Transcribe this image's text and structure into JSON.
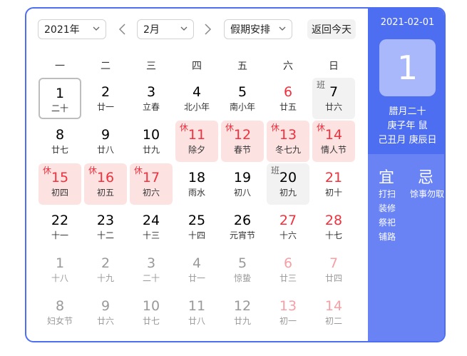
{
  "toolbar": {
    "year_value": "2021年",
    "month_value": "2月",
    "holiday_value": "假期安排",
    "today_label": "返回今天"
  },
  "weekdays": [
    "一",
    "二",
    "三",
    "四",
    "五",
    "六",
    "日"
  ],
  "days": [
    {
      "num": "1",
      "lunar": "二十",
      "today": true
    },
    {
      "num": "2",
      "lunar": "廿一"
    },
    {
      "num": "3",
      "lunar": "立春"
    },
    {
      "num": "4",
      "lunar": "北小年"
    },
    {
      "num": "5",
      "lunar": "南小年"
    },
    {
      "num": "6",
      "lunar": "廿五",
      "red": true
    },
    {
      "num": "7",
      "lunar": "廿六",
      "tag": "班",
      "type": "work"
    },
    {
      "num": "8",
      "lunar": "廿七"
    },
    {
      "num": "9",
      "lunar": "廿八"
    },
    {
      "num": "10",
      "lunar": "廿九"
    },
    {
      "num": "11",
      "lunar": "除夕",
      "tag": "休",
      "type": "rest"
    },
    {
      "num": "12",
      "lunar": "春节",
      "tag": "休",
      "type": "rest"
    },
    {
      "num": "13",
      "lunar": "冬七九",
      "tag": "休",
      "type": "rest"
    },
    {
      "num": "14",
      "lunar": "情人节",
      "tag": "休",
      "type": "rest"
    },
    {
      "num": "15",
      "lunar": "初四",
      "tag": "休",
      "type": "rest"
    },
    {
      "num": "16",
      "lunar": "初五",
      "tag": "休",
      "type": "rest"
    },
    {
      "num": "17",
      "lunar": "初六",
      "tag": "休",
      "type": "rest"
    },
    {
      "num": "18",
      "lunar": "雨水"
    },
    {
      "num": "19",
      "lunar": "初八"
    },
    {
      "num": "20",
      "lunar": "初九",
      "tag": "班",
      "type": "work"
    },
    {
      "num": "21",
      "lunar": "初十",
      "red": true
    },
    {
      "num": "22",
      "lunar": "十一"
    },
    {
      "num": "23",
      "lunar": "十二"
    },
    {
      "num": "24",
      "lunar": "十三"
    },
    {
      "num": "25",
      "lunar": "十四"
    },
    {
      "num": "26",
      "lunar": "元宵节"
    },
    {
      "num": "27",
      "lunar": "十六",
      "red": true
    },
    {
      "num": "28",
      "lunar": "十七",
      "red": true
    },
    {
      "num": "1",
      "lunar": "十八",
      "other": true
    },
    {
      "num": "2",
      "lunar": "十九",
      "other": true
    },
    {
      "num": "3",
      "lunar": "二十",
      "other": true
    },
    {
      "num": "4",
      "lunar": "廿一",
      "other": true
    },
    {
      "num": "5",
      "lunar": "惊蛰",
      "other": true
    },
    {
      "num": "6",
      "lunar": "廿三",
      "other": true,
      "red": true
    },
    {
      "num": "7",
      "lunar": "廿四",
      "other": true,
      "red": true
    },
    {
      "num": "8",
      "lunar": "妇女节",
      "other": true
    },
    {
      "num": "9",
      "lunar": "廿六",
      "other": true
    },
    {
      "num": "10",
      "lunar": "廿七",
      "other": true
    },
    {
      "num": "11",
      "lunar": "廿八",
      "other": true
    },
    {
      "num": "12",
      "lunar": "廿九",
      "other": true
    },
    {
      "num": "13",
      "lunar": "初一",
      "other": true,
      "red": true
    },
    {
      "num": "14",
      "lunar": "初二",
      "other": true,
      "red": true
    }
  ],
  "panel": {
    "date": "2021-02-01",
    "day": "1",
    "lunar_date": "腊月二十",
    "ganzhi_year": "庚子年 鼠",
    "ganzhi_month_day": "己丑月 庚辰日",
    "yi_label": "宜",
    "ji_label": "忌",
    "yi_items": [
      "打扫",
      "装修",
      "祭祀",
      "铺路"
    ],
    "ji_items": [
      "馀事勿取"
    ]
  },
  "colors": {
    "accent": "#4e6ef2",
    "holiday": "#f0313e",
    "rest_bg": "#fde2e2"
  }
}
